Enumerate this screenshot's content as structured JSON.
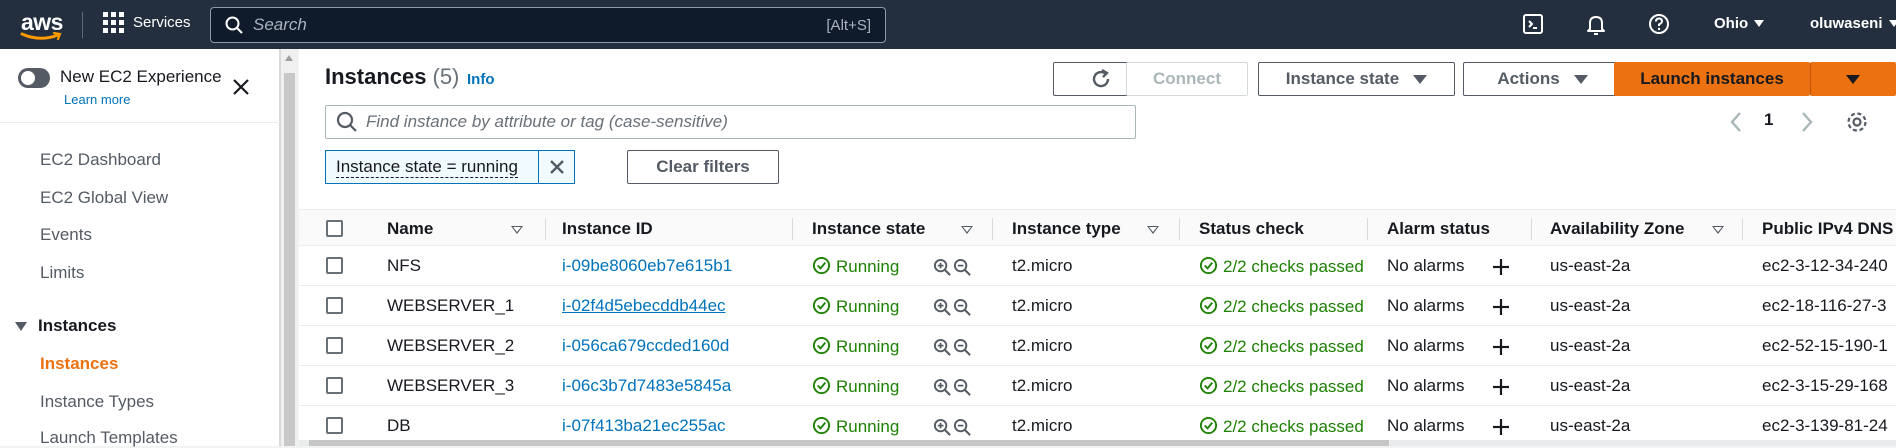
{
  "topbar": {
    "logo_text": "aws",
    "services_label": "Services",
    "search_placeholder": "Search",
    "search_shortcut": "[Alt+S]",
    "region_label": "Ohio",
    "user_label": "oluwaseni",
    "icons": [
      "cloudshell-icon",
      "bell-icon",
      "help-icon"
    ]
  },
  "sidebar": {
    "toggle_label": "New EC2 Experience",
    "learn_more": "Learn more",
    "items": [
      {
        "label": "EC2 Dashboard"
      },
      {
        "label": "EC2 Global View"
      },
      {
        "label": "Events"
      },
      {
        "label": "Limits"
      }
    ],
    "section": "Instances",
    "section_items": [
      {
        "label": "Instances",
        "active": true
      },
      {
        "label": "Instance Types"
      },
      {
        "label": "Launch Templates"
      }
    ]
  },
  "header": {
    "title": "Instances",
    "count": "(5)",
    "info": "Info",
    "connect": "Connect",
    "instance_state": "Instance state",
    "actions": "Actions",
    "launch": "Launch instances"
  },
  "filter": {
    "placeholder": "Find instance by attribute or tag (case-sensitive)",
    "chip": "Instance state = running",
    "clear": "Clear filters",
    "page": "1"
  },
  "table": {
    "columns": [
      "Name",
      "Instance ID",
      "Instance state",
      "Instance type",
      "Status check",
      "Alarm status",
      "Availability Zone",
      "Public IPv4 DNS"
    ],
    "rows": [
      {
        "name": "NFS",
        "id": "i-09be8060eb7e615b1",
        "state": "Running",
        "type": "t2.micro",
        "check": "2/2 checks passed",
        "alarm": "No alarms",
        "az": "us-east-2a",
        "dns": "ec2-3-12-34-240"
      },
      {
        "name": "WEBSERVER_1",
        "id": "i-02f4d5ebecddb44ec",
        "state": "Running",
        "type": "t2.micro",
        "check": "2/2 checks passed",
        "alarm": "No alarms",
        "az": "us-east-2a",
        "dns": "ec2-18-116-27-3"
      },
      {
        "name": "WEBSERVER_2",
        "id": "i-056ca679ccded160d",
        "state": "Running",
        "type": "t2.micro",
        "check": "2/2 checks passed",
        "alarm": "No alarms",
        "az": "us-east-2a",
        "dns": "ec2-52-15-190-1"
      },
      {
        "name": "WEBSERVER_3",
        "id": "i-06c3b7d7483e5845a",
        "state": "Running",
        "type": "t2.micro",
        "check": "2/2 checks passed",
        "alarm": "No alarms",
        "az": "us-east-2a",
        "dns": "ec2-3-15-29-168"
      },
      {
        "name": "DB",
        "id": "i-07f413ba21ec255ac",
        "state": "Running",
        "type": "t2.micro",
        "check": "2/2 checks passed",
        "alarm": "No alarms",
        "az": "us-east-2a",
        "dns": "ec2-3-139-81-24"
      }
    ]
  },
  "colors": {
    "topbar": "#232f3e",
    "accent_orange": "#ec7211",
    "link_blue": "#0073bb",
    "success_green": "#1d8102"
  }
}
